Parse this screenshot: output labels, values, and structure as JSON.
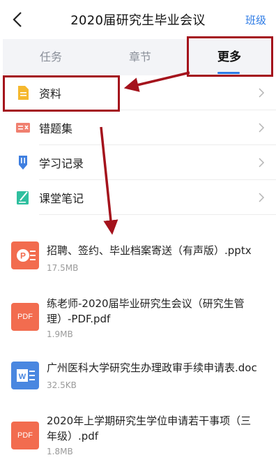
{
  "header": {
    "back_icon": "chevron-left-icon",
    "title": "2020届研究生毕业会议",
    "class_link": "班级"
  },
  "tabs": [
    {
      "label": "任务",
      "active": false
    },
    {
      "label": "章节",
      "active": false
    },
    {
      "label": "更多",
      "active": true
    }
  ],
  "menu": [
    {
      "label": "资料",
      "icon": "document-icon",
      "color": "#f5b82e"
    },
    {
      "label": "错题集",
      "icon": "error-collection-icon",
      "color": "#f08070"
    },
    {
      "label": "学习记录",
      "icon": "study-record-icon",
      "color": "#3f7fe0"
    },
    {
      "label": "课堂笔记",
      "icon": "note-icon",
      "color": "#2fbf9f"
    }
  ],
  "files": [
    {
      "name_line1": "招聘、签约、毕业档案寄送（有声版）.pptx",
      "name_line2": "",
      "size": "17.5MB",
      "type": "pptx",
      "icon_label": ""
    },
    {
      "name_line1": "练老师-2020届毕业研究生会议（研究生管",
      "name_line2": "理）-PDF.pdf",
      "size": "1.9MB",
      "type": "pdf",
      "icon_label": "PDF"
    },
    {
      "name_line1": "广州医科大学研究生办理政审手续申请表.doc",
      "name_line2": "",
      "size": "32.5KB",
      "type": "doc",
      "icon_label": ""
    },
    {
      "name_line1": "2020年上学期研究生学位申请若干事项（三",
      "name_line2": "年级）.pdf",
      "size": "1.8MB",
      "type": "pdf",
      "icon_label": "PDF"
    }
  ],
  "colors": {
    "accent": "#2d7be5",
    "annotation": "#a4121c",
    "file_pdf": "#f26c4f",
    "file_doc": "#4a87e0"
  }
}
